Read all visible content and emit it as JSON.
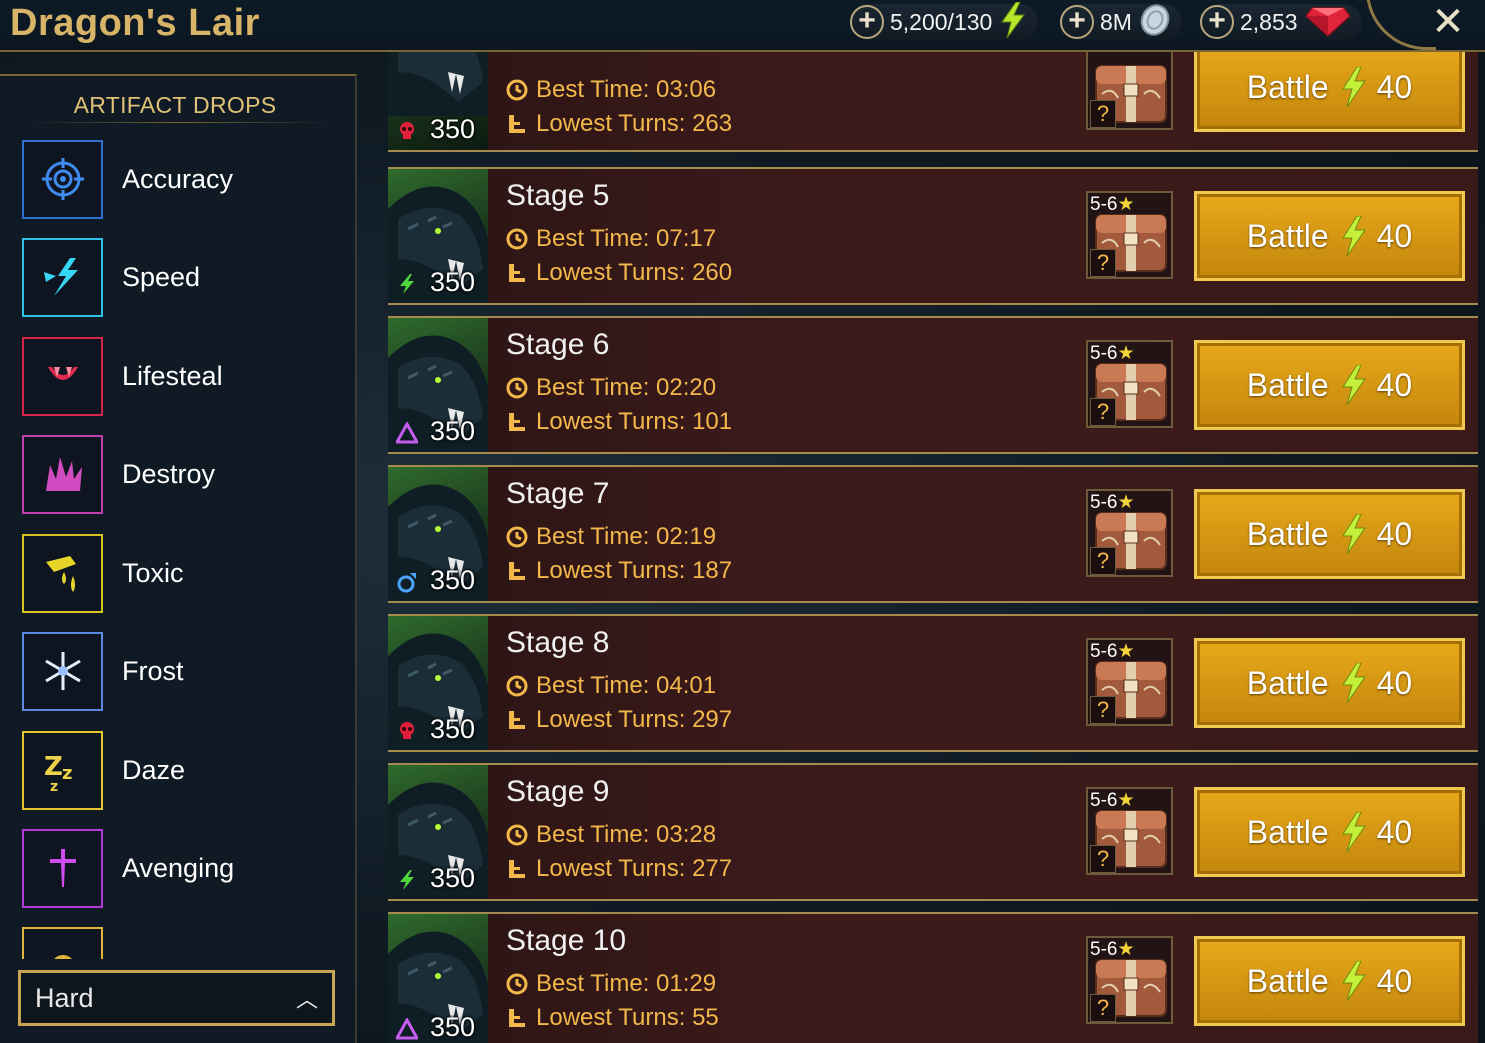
{
  "header": {
    "title": "Dragon's Lair",
    "energy": "5,200/130",
    "silver": "8M",
    "gems": "2,853"
  },
  "artifact_drops": {
    "heading": "ARTIFACT DROPS",
    "items": [
      {
        "label": "Accuracy",
        "icon": "accuracy-icon",
        "color": "#2f71d1"
      },
      {
        "label": "Speed",
        "icon": "speed-icon",
        "color": "#2ec2e7"
      },
      {
        "label": "Lifesteal",
        "icon": "lifesteal-icon",
        "color": "#d8244a"
      },
      {
        "label": "Destroy",
        "icon": "destroy-icon",
        "color": "#c23fae"
      },
      {
        "label": "Toxic",
        "icon": "toxic-icon",
        "color": "#d9c51d"
      },
      {
        "label": "Frost",
        "icon": "frost-icon",
        "color": "#5b8ae0"
      },
      {
        "label": "Daze",
        "icon": "daze-icon",
        "color": "#e4c431"
      },
      {
        "label": "Avenging",
        "icon": "avenging-icon",
        "color": "#b23ad9"
      },
      {
        "label": "",
        "icon": "stalwart-icon",
        "color": "#e0b43a"
      }
    ],
    "difficulty": "Hard"
  },
  "stages": [
    {
      "name": "",
      "best_time": "Best Time: 03:06",
      "lowest_turns": "Lowest Turns: 263",
      "energy": "350",
      "affinity": "force",
      "chest": "",
      "battle_label": "Battle",
      "battle_cost": "40"
    },
    {
      "name": "Stage 5",
      "best_time": "Best Time: 07:17",
      "lowest_turns": "Lowest Turns: 260",
      "energy": "350",
      "affinity": "magic",
      "chest": "5-6",
      "battle_label": "Battle",
      "battle_cost": "40"
    },
    {
      "name": "Stage 6",
      "best_time": "Best Time: 02:20",
      "lowest_turns": "Lowest Turns: 101",
      "energy": "350",
      "affinity": "void",
      "chest": "5-6",
      "battle_label": "Battle",
      "battle_cost": "40"
    },
    {
      "name": "Stage 7",
      "best_time": "Best Time: 02:19",
      "lowest_turns": "Lowest Turns: 187",
      "energy": "350",
      "affinity": "spirit",
      "chest": "5-6",
      "battle_label": "Battle",
      "battle_cost": "40"
    },
    {
      "name": "Stage 8",
      "best_time": "Best Time: 04:01",
      "lowest_turns": "Lowest Turns: 297",
      "energy": "350",
      "affinity": "force",
      "chest": "5-6",
      "battle_label": "Battle",
      "battle_cost": "40"
    },
    {
      "name": "Stage 9",
      "best_time": "Best Time: 03:28",
      "lowest_turns": "Lowest Turns: 277",
      "energy": "350",
      "affinity": "magic",
      "chest": "5-6",
      "battle_label": "Battle",
      "battle_cost": "40"
    },
    {
      "name": "Stage 10",
      "best_time": "Best Time: 01:29",
      "lowest_turns": "Lowest Turns: 55",
      "energy": "350",
      "affinity": "void",
      "chest": "5-6",
      "battle_label": "Battle",
      "battle_cost": "40"
    }
  ]
}
